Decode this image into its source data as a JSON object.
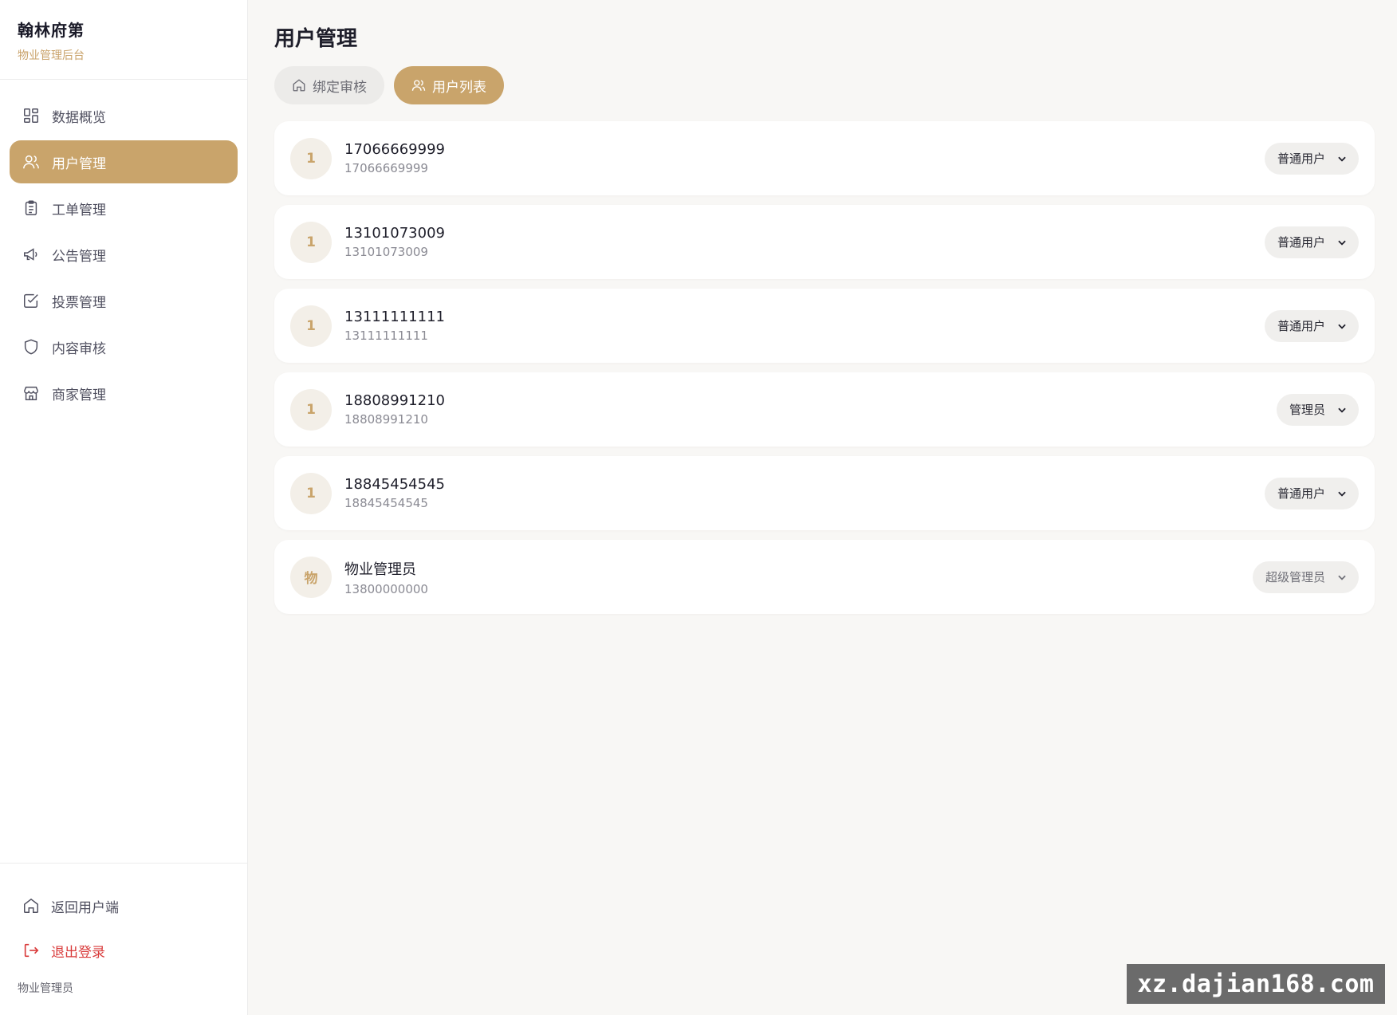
{
  "brand": {
    "title": "翰林府第",
    "subtitle": "物业管理后台"
  },
  "nav": {
    "items": [
      {
        "label": "数据概览",
        "icon": "grid-icon",
        "active": false
      },
      {
        "label": "用户管理",
        "icon": "users-icon",
        "active": true
      },
      {
        "label": "工单管理",
        "icon": "clipboard-icon",
        "active": false
      },
      {
        "label": "公告管理",
        "icon": "megaphone-icon",
        "active": false
      },
      {
        "label": "投票管理",
        "icon": "checkbox-icon",
        "active": false
      },
      {
        "label": "内容审核",
        "icon": "shield-icon",
        "active": false
      },
      {
        "label": "商家管理",
        "icon": "store-icon",
        "active": false
      }
    ]
  },
  "footer": {
    "back_label": "返回用户端",
    "logout_label": "退出登录",
    "current_user": "物业管理员"
  },
  "page": {
    "title": "用户管理"
  },
  "tabs": [
    {
      "label": "绑定审核",
      "icon": "home-icon",
      "active": false
    },
    {
      "label": "用户列表",
      "icon": "users-icon",
      "active": true
    }
  ],
  "users": [
    {
      "avatar": "1",
      "name": "17066669999",
      "phone": "17066669999",
      "role": "普通用户"
    },
    {
      "avatar": "1",
      "name": "13101073009",
      "phone": "13101073009",
      "role": "普通用户"
    },
    {
      "avatar": "1",
      "name": "13111111111",
      "phone": "13111111111",
      "role": "普通用户"
    },
    {
      "avatar": "1",
      "name": "18808991210",
      "phone": "18808991210",
      "role": "管理员"
    },
    {
      "avatar": "1",
      "name": "18845454545",
      "phone": "18845454545",
      "role": "普通用户"
    },
    {
      "avatar": "物",
      "name": "物业管理员",
      "phone": "13800000000",
      "role": "超级管理员"
    }
  ],
  "watermark": "xz.dajian168.com",
  "colors": {
    "accent": "#c9a46b",
    "danger": "#d93b3b",
    "background": "#f8f7f5"
  }
}
